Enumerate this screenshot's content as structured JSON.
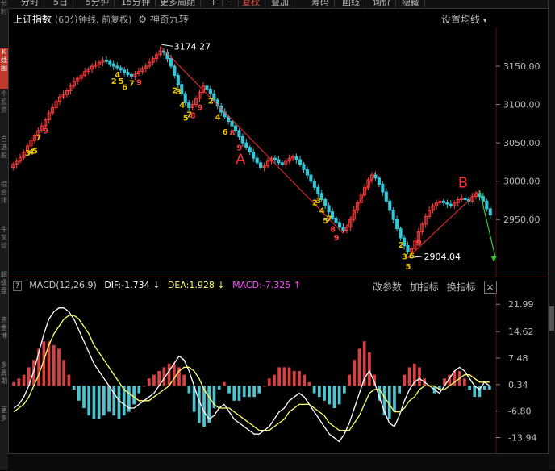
{
  "top_tabs": [
    "分时",
    "5日",
    "5分钟",
    "15分钟",
    "更多周期",
    "+",
    "−",
    "复权",
    "叠加",
    "筹码",
    "画线",
    "询价",
    "隐藏"
  ],
  "top_tab_active": "复权",
  "left_tabs": [
    "分时",
    "K线图",
    "个股资料",
    "自选股",
    "综合排名",
    "牛叉诊股",
    "超级盘口",
    "资金博弈",
    "多周期图",
    "更多"
  ],
  "left_tab_active": "K线图",
  "header": {
    "title": "上证指数",
    "subtitle": "(60分钟线, 前复权)",
    "gear_label": "神奇九转",
    "settings": "设置均线"
  },
  "macd_header": {
    "name": "MACD(12,26,9)",
    "dif": "DIF:-1.734",
    "dif_arrow": "↓",
    "dea": "DEA:1.928",
    "dea_arrow": "↓",
    "macd": "MACD:-7.325",
    "macd_arrow": "↑",
    "change_params": "改参数",
    "add_indicator": "加指标",
    "switch_indicator": "换指标",
    "close": "×"
  },
  "colors": {
    "up": "#ff3b3b",
    "down": "#33c8d8",
    "dif": "#ffffff",
    "dea": "#ffff66",
    "nine_yellow": "#e8c000",
    "nine_red": "#ff4040",
    "nine_green": "#33cc33",
    "annotation": "#ff2a2a",
    "macd_pos": "#d94040",
    "macd_neg": "#4fc3d0"
  },
  "chart_data": [
    {
      "type": "candlestick",
      "title": "上证指数",
      "ylim": [
        2885,
        3190
      ],
      "yticks": [
        "3150.00",
        "3100.00",
        "3050.00",
        "3000.00",
        "2950.00"
      ],
      "high_label": "3174.27",
      "low_label": "2904.04",
      "annotations": [
        "A",
        "B"
      ],
      "nine_turn_labels": [
        "3",
        "4",
        "5",
        "7",
        "9",
        "2",
        "4",
        "5",
        "6",
        "7",
        "9",
        "2",
        "3",
        "4",
        "5",
        "7",
        "8",
        "9",
        "2",
        "4",
        "6",
        "8",
        "9",
        "2",
        "3",
        "4",
        "5",
        "7",
        "8",
        "9",
        "2",
        "3",
        "5",
        "6",
        "9"
      ],
      "close": [
        3022,
        3026,
        3031,
        3038,
        3046,
        3053,
        3059,
        3066,
        3072,
        3080,
        3089,
        3096,
        3104,
        3110,
        3113,
        3118,
        3124,
        3130,
        3134,
        3138,
        3143,
        3146,
        3150,
        3152,
        3155,
        3158,
        3156,
        3153,
        3150,
        3148,
        3145,
        3142,
        3139,
        3137,
        3140,
        3143,
        3147,
        3150,
        3155,
        3160,
        3165,
        3170,
        3168,
        3160,
        3150,
        3138,
        3126,
        3114,
        3102,
        3096,
        3100,
        3108,
        3116,
        3124,
        3120,
        3114,
        3106,
        3098,
        3090,
        3084,
        3078,
        3072,
        3066,
        3058,
        3050,
        3044,
        3038,
        3030,
        3024,
        3018,
        3020,
        3026,
        3030,
        3028,
        3024,
        3022,
        3026,
        3030,
        3032,
        3028,
        3022,
        3015,
        3008,
        3000,
        2992,
        2984,
        2976,
        2968,
        2960,
        2952,
        2946,
        2940,
        2936,
        2940,
        2950,
        2962,
        2972,
        2982,
        2992,
        3002,
        3008,
        3004,
        2996,
        2986,
        2974,
        2962,
        2950,
        2938,
        2926,
        2916,
        2908,
        2912,
        2922,
        2934,
        2944,
        2954,
        2962,
        2968,
        2972,
        2974,
        2972,
        2970,
        2968,
        2972,
        2976,
        2978,
        2976,
        2974,
        2980,
        2984,
        2980,
        2974,
        2964,
        2956
      ]
    },
    {
      "type": "macd",
      "title": "MACD(12,26,9)",
      "ylim": [
        -16,
        24
      ],
      "yticks": [
        "21.99",
        "14.62",
        "7.48",
        "0.34",
        "-6.80",
        "-13.94"
      ],
      "dif": [
        -6,
        -5,
        -3,
        0,
        4,
        9,
        14,
        18,
        20,
        21,
        21,
        20,
        18,
        15,
        12,
        9,
        6,
        4,
        2,
        0,
        -2,
        -4,
        -5,
        -6,
        -6,
        -5,
        -4,
        -3,
        -2,
        0,
        2,
        4,
        6,
        8,
        7,
        4,
        0,
        -4,
        -7,
        -9,
        -8,
        -6,
        -5,
        -7,
        -9,
        -10,
        -11,
        -12,
        -13,
        -13,
        -12,
        -11,
        -9,
        -7,
        -6,
        -4,
        -3,
        -2,
        -3,
        -5,
        -7,
        -9,
        -11,
        -13,
        -14,
        -15,
        -13,
        -10,
        -6,
        -2,
        2,
        4,
        1,
        -3,
        -7,
        -10,
        -11,
        -8,
        -4,
        -1,
        1,
        2,
        1,
        0,
        -1,
        -2,
        0,
        2,
        4,
        5,
        4,
        2,
        0,
        -1,
        1,
        0
      ],
      "dea": [
        -7,
        -6,
        -5,
        -3,
        0,
        3,
        7,
        11,
        14,
        16,
        18,
        19,
        19,
        18,
        16,
        14,
        11,
        9,
        7,
        5,
        3,
        1,
        -1,
        -2,
        -3,
        -4,
        -4,
        -4,
        -3,
        -2,
        -1,
        0,
        2,
        4,
        5,
        5,
        4,
        2,
        -1,
        -3,
        -5,
        -6,
        -6,
        -6,
        -7,
        -8,
        -9,
        -10,
        -11,
        -12,
        -12,
        -12,
        -11,
        -10,
        -9,
        -7,
        -6,
        -5,
        -5,
        -5,
        -6,
        -7,
        -8,
        -10,
        -11,
        -12,
        -12,
        -12,
        -10,
        -8,
        -5,
        -2,
        -1,
        -1,
        -3,
        -5,
        -7,
        -7,
        -6,
        -4,
        -3,
        -1,
        0,
        0,
        0,
        -1,
        -1,
        0,
        1,
        2,
        3,
        3,
        2,
        1,
        1,
        1
      ],
      "macd": [
        1,
        2,
        3,
        5,
        7,
        10,
        12,
        12,
        11,
        10,
        7,
        3,
        -1,
        -4,
        -6,
        -8,
        -9,
        -9,
        -8,
        -7,
        -8,
        -9,
        -8,
        -7,
        -5,
        -2,
        0,
        2,
        3,
        4,
        5,
        6,
        6,
        5,
        3,
        -2,
        -7,
        -10,
        -11,
        -10,
        -6,
        -1,
        1,
        -2,
        -4,
        -4,
        -3,
        -3,
        -3,
        -2,
        0,
        2,
        3,
        5,
        5,
        5,
        4,
        4,
        3,
        1,
        -2,
        -3,
        -4,
        -5,
        -6,
        -5,
        -2,
        3,
        7,
        10,
        12,
        9,
        3,
        -4,
        -8,
        -9,
        -7,
        -2,
        3,
        5,
        6,
        5,
        2,
        0,
        -2,
        -1,
        2,
        3,
        4,
        4,
        2,
        -1,
        -3,
        -3,
        -1,
        -1
      ]
    }
  ]
}
